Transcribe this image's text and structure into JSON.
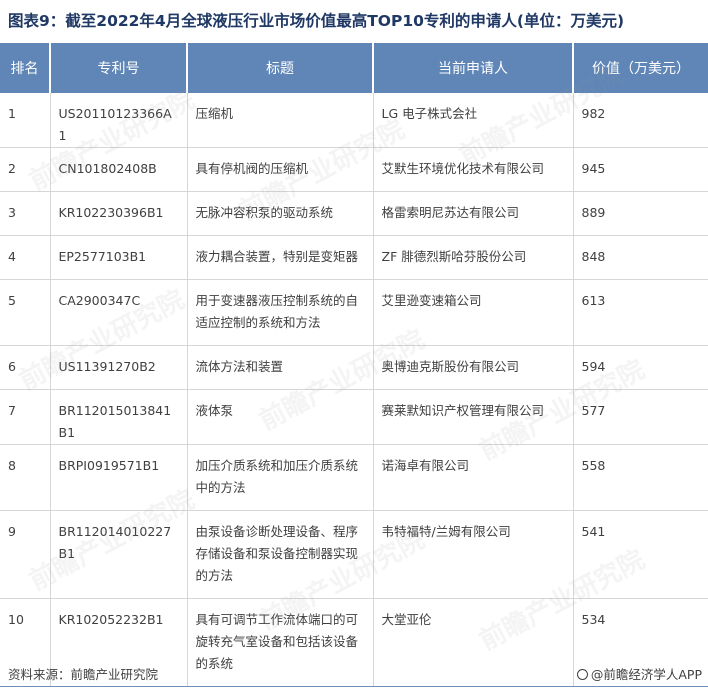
{
  "title": "图表9：截至2022年4月全球液压行业市场价值最高TOP10专利的申请人(单位：万美元)",
  "table": {
    "headers": [
      "排名",
      "专利号",
      "标题",
      "当前申请人",
      "价值（万美元）"
    ],
    "rows": [
      {
        "rank": "1",
        "patent": "US20110123366A1",
        "title": "压缩机",
        "applicant": "LG 电子株式会社",
        "value": "982"
      },
      {
        "rank": "2",
        "patent": "CN101802408B",
        "title": "具有停机阀的压缩机",
        "applicant": "艾默生环境优化技术有限公司",
        "value": "945"
      },
      {
        "rank": "3",
        "patent": "KR102230396B1",
        "title": "无脉冲容积泵的驱动系统",
        "applicant": "格雷索明尼苏达有限公司",
        "value": "889"
      },
      {
        "rank": "4",
        "patent": "EP2577103B1",
        "title": "液力耦合装置，特别是变矩器",
        "applicant": "ZF 腓德烈斯哈芬股份公司",
        "value": "848"
      },
      {
        "rank": "5",
        "patent": "CA2900347C",
        "title": "用于变速器液压控制系统的自适应控制的系统和方法",
        "applicant": "艾里逊变速箱公司",
        "value": "613"
      },
      {
        "rank": "6",
        "patent": "US11391270B2",
        "title": "流体方法和装置",
        "applicant": "奥博迪克斯股份有限公司",
        "value": "594"
      },
      {
        "rank": "7",
        "patent": "BR112015013841B1",
        "title": "液体泵",
        "applicant": "赛莱默知识产权管理有限公司",
        "value": "577"
      },
      {
        "rank": "8",
        "patent": "BRPI0919571B1",
        "title": "加压介质系统和加压介质系统中的方法",
        "applicant": "诺海卓有限公司",
        "value": "558"
      },
      {
        "rank": "9",
        "patent": "BR112014010227B1",
        "title": "由泵设备诊断处理设备、程序存储设备和泵设备控制器实现的方法",
        "applicant": "韦特福特/兰姆有限公司",
        "value": "541"
      },
      {
        "rank": "10",
        "patent": "KR102052232B1",
        "title": "具有可调节工作流体端口的可旋转充气室设备和包括该设备的系统",
        "applicant": "大堂亚伦",
        "value": "534"
      }
    ]
  },
  "footer": {
    "source": "资料来源：前瞻产业研究院",
    "brand": "@前瞻经济学人APP"
  },
  "watermark": "前瞻产业研究院",
  "colors": {
    "header_bg": "#5f86b7",
    "title_color": "#1f3864"
  }
}
